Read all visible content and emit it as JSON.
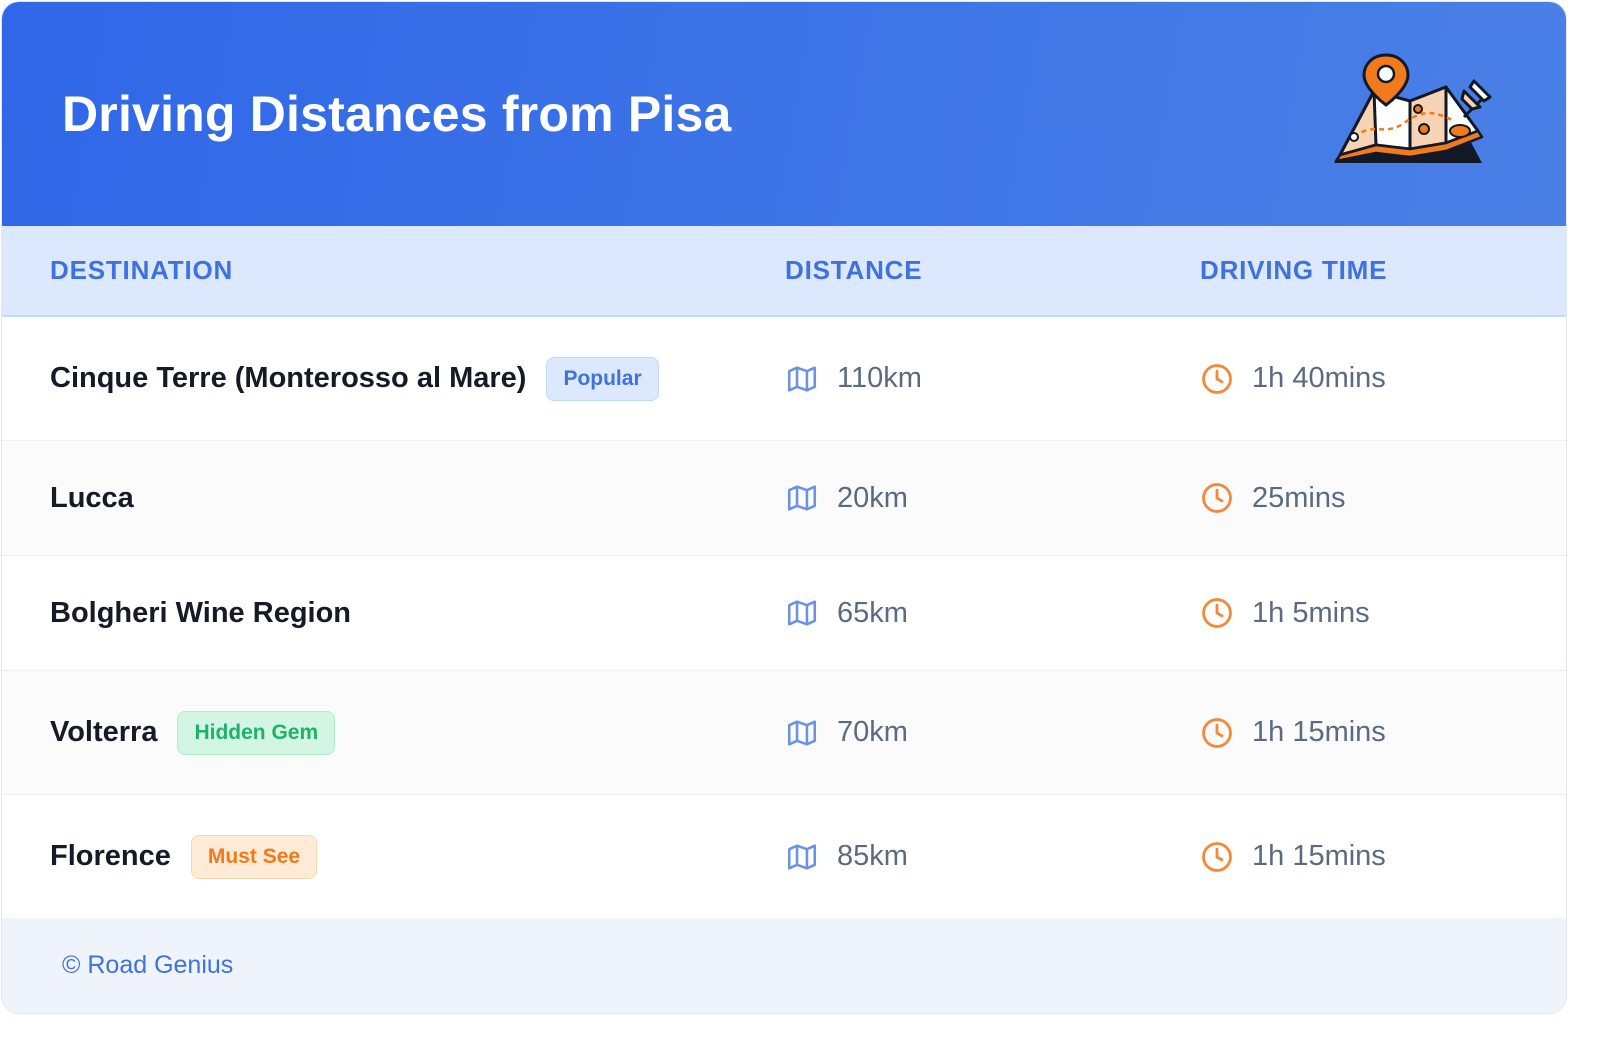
{
  "header": {
    "title": "Driving Distances from Pisa",
    "illustration_icon": "map-with-pins-icon"
  },
  "table": {
    "columns": [
      "DESTINATION",
      "DISTANCE",
      "DRIVING TIME"
    ],
    "rows": [
      {
        "destination": "Cinque Terre (Monterosso al Mare)",
        "badge": "Popular",
        "badge_color": "#3e73dc",
        "distance": "110km",
        "time": "1h 40mins"
      },
      {
        "destination": "Lucca",
        "badge": "",
        "badge_color": "",
        "distance": "20km",
        "time": "25mins"
      },
      {
        "destination": "Bolgheri Wine Region",
        "badge": "",
        "badge_color": "",
        "distance": "65km",
        "time": "1h 5mins"
      },
      {
        "destination": "Volterra",
        "badge": "Hidden Gem",
        "badge_color": "#1fb26b",
        "distance": "70km",
        "time": "1h 15mins"
      },
      {
        "destination": "Florence",
        "badge": "Must See",
        "badge_color": "#f07a1c",
        "distance": "85km",
        "time": "1h 15mins"
      }
    ],
    "distance_icon": "map-icon",
    "time_icon": "clock-icon"
  },
  "footer": {
    "copyright": "© Road Genius"
  },
  "colors": {
    "header_start": "#2f67e8",
    "header_end": "#4a80e6",
    "header_row": "#dbe8fd",
    "accent_blue": "#3f72dd",
    "accent_orange": "#f28a3c"
  }
}
